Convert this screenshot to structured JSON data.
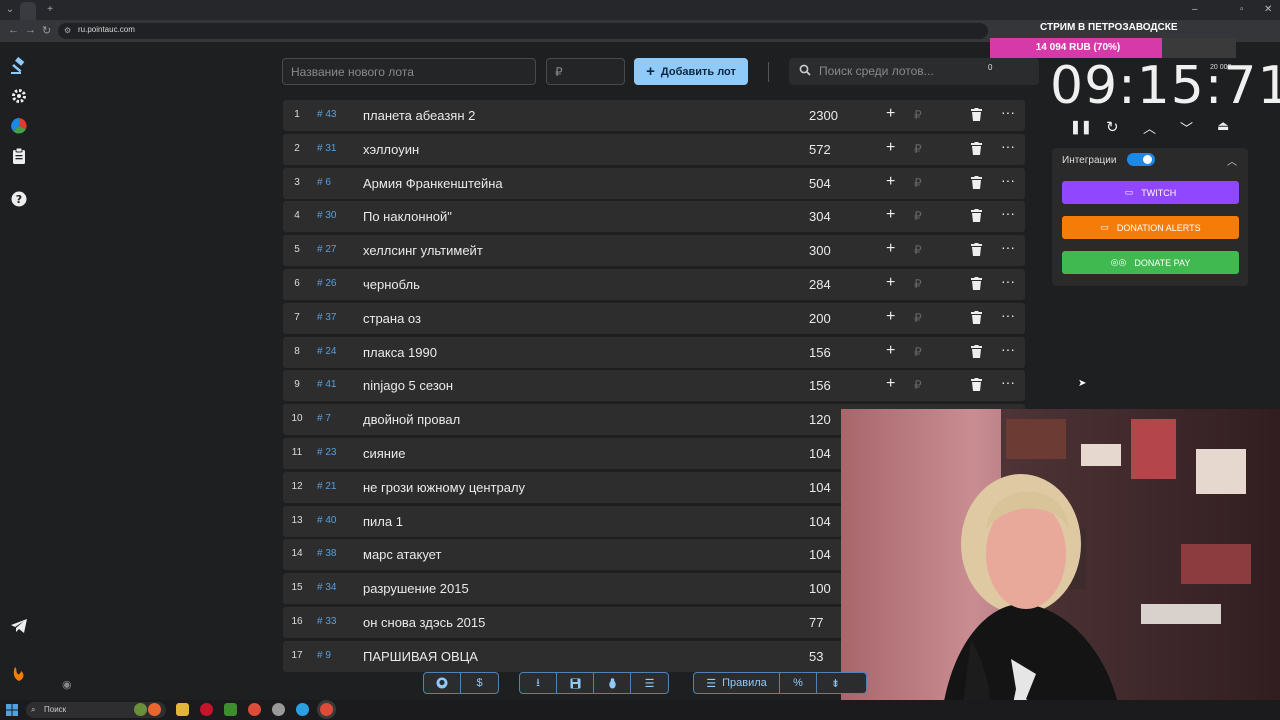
{
  "browser": {
    "url": "ru.pointauc.com"
  },
  "controls": {
    "lot_name_placeholder": "Название нового лота",
    "price_placeholder": "₽",
    "add_lot_label": "Добавить лот",
    "search_placeholder": "Поиск среди лотов...",
    "search_count": "0"
  },
  "lots": [
    {
      "idx": "1",
      "id": "# 43",
      "name": "планета абеазян 2",
      "amount": "2300"
    },
    {
      "idx": "2",
      "id": "# 31",
      "name": "хэллоуин",
      "amount": "572"
    },
    {
      "idx": "3",
      "id": "# 6",
      "name": "Армия Франкенштейна",
      "amount": "504"
    },
    {
      "idx": "4",
      "id": "# 30",
      "name": "По наклонной\"",
      "amount": "304"
    },
    {
      "idx": "5",
      "id": "# 27",
      "name": "хеллсинг ультимейт",
      "amount": "300"
    },
    {
      "idx": "6",
      "id": "# 26",
      "name": "чернобль",
      "amount": "284"
    },
    {
      "idx": "7",
      "id": "# 37",
      "name": "страна оз",
      "amount": "200"
    },
    {
      "idx": "8",
      "id": "# 24",
      "name": "плакса 1990",
      "amount": "156"
    },
    {
      "idx": "9",
      "id": "# 41",
      "name": "ninjago 5 сезон",
      "amount": "156"
    },
    {
      "idx": "10",
      "id": "# 7",
      "name": " двойной провал",
      "amount": "120"
    },
    {
      "idx": "11",
      "id": "# 23",
      "name": "сияние",
      "amount": "104"
    },
    {
      "idx": "12",
      "id": "# 21",
      "name": "не грози южному централу",
      "amount": "104"
    },
    {
      "idx": "13",
      "id": "# 40",
      "name": "пила 1",
      "amount": "104"
    },
    {
      "idx": "14",
      "id": "# 38",
      "name": "марс атакует",
      "amount": "104"
    },
    {
      "idx": "15",
      "id": "# 34",
      "name": "разрушение 2015",
      "amount": "100"
    },
    {
      "idx": "16",
      "id": "# 33",
      "name": "он снова здэсь 2015",
      "amount": "77"
    },
    {
      "idx": "17",
      "id": "# 9",
      "name": "ПАРШИВАЯ ОВЦА",
      "amount": "53"
    }
  ],
  "row_rub_symbol": "₽",
  "stream": {
    "title": "СТРИМ В ПЕТРОЗАВОДСКЕ",
    "progress_text": "14 094 RUB (70%)",
    "progress_fraction": 0.7,
    "progress_max": "20 000",
    "timer": "09:15:71"
  },
  "integrations": {
    "title": "Интеграции",
    "twitch": "TWITCH",
    "donation_alerts": "DONATION ALERTS",
    "donate_pay": "DONATE PAY"
  },
  "toolbar": {
    "rules_label": "Правила"
  },
  "taskbar": {
    "search_label": "Поиск"
  },
  "colors": {
    "accent": "#90caf9",
    "twitch": "#9146ff",
    "donation_alerts": "#f57d07",
    "donate_pay": "#3fb950",
    "progress": "#d63aa9"
  }
}
